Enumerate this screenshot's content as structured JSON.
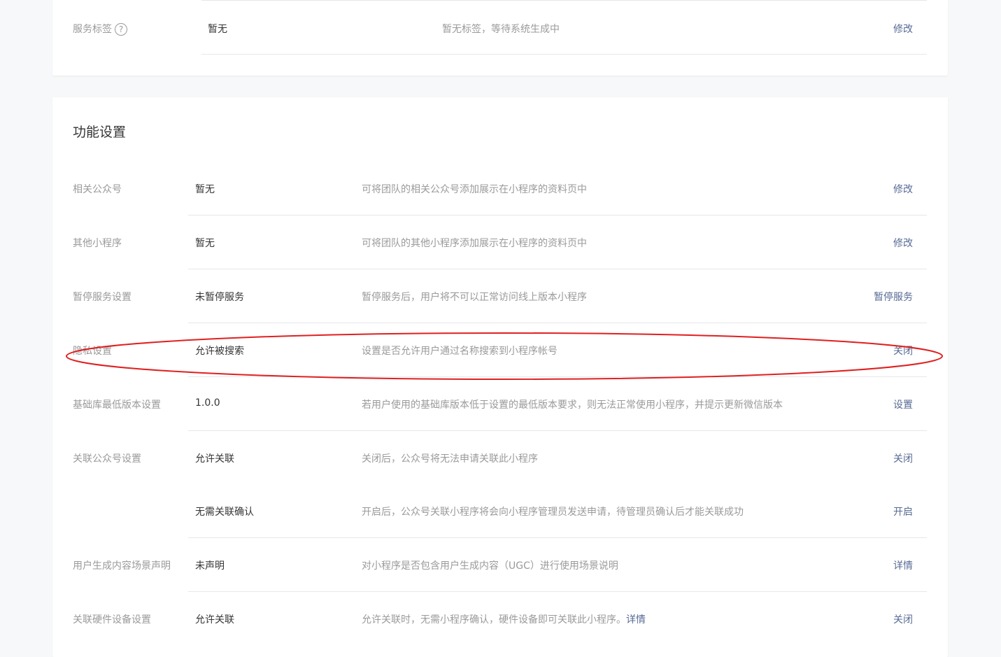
{
  "top_card": {
    "label": "服务标签",
    "help_icon": "?",
    "value": "暂无",
    "desc": "暂无标签，等待系统生成中",
    "action": "修改"
  },
  "main_card": {
    "title": "功能设置",
    "rows": [
      {
        "label": "相关公众号",
        "value": "暂无",
        "desc": "可将团队的相关公众号添加展示在小程序的资料页中",
        "action": "修改"
      },
      {
        "label": "其他小程序",
        "value": "暂无",
        "desc": "可将团队的其他小程序添加展示在小程序的资料页中",
        "action": "修改"
      },
      {
        "label": "暂停服务设置",
        "value": "未暂停服务",
        "desc": "暂停服务后，用户将不可以正常访问线上版本小程序",
        "action": "暂停服务"
      },
      {
        "label": "隐私设置",
        "value": "允许被搜索",
        "desc": "设置是否允许用户通过名称搜索到小程序帐号",
        "action": "关闭"
      },
      {
        "label": "基础库最低版本设置",
        "value": "1.0.0",
        "desc": "若用户使用的基础库版本低于设置的最低版本要求，则无法正常使用小程序，并提示更新微信版本",
        "action": "设置"
      },
      {
        "label": "关联公众号设置",
        "value": "允许关联",
        "desc": "关闭后，公众号将无法申请关联此小程序",
        "action": "关闭"
      },
      {
        "label": "",
        "value": "无需关联确认",
        "desc": "开启后，公众号关联小程序将会向小程序管理员发送申请，待管理员确认后才能关联成功",
        "action": "开启"
      },
      {
        "label": "用户生成内容场景声明",
        "value": "未声明",
        "desc": "对小程序是否包含用户生成内容（UGC）进行使用场景说明",
        "action": "详情"
      },
      {
        "label": "关联硬件设备设置",
        "value": "允许关联",
        "desc": "允许关联时，无需小程序确认，硬件设备即可关联此小程序。",
        "desc_link": "详情",
        "action": "关闭"
      }
    ]
  },
  "colors": {
    "annotation_stroke": "#e02020",
    "link": "#576b95",
    "muted_text": "#9a9a9a",
    "body_text": "#353535"
  }
}
